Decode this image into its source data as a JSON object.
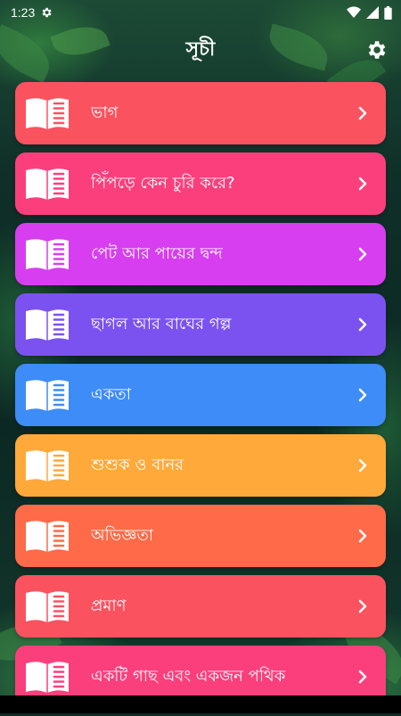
{
  "status_bar": {
    "time": "1:23",
    "icons": [
      "gear-icon",
      "wifi-icon",
      "signal-icon",
      "battery-icon"
    ]
  },
  "app_bar": {
    "title": "সূচী",
    "settings_icon": "gear-icon"
  },
  "list": {
    "item_icon": "book-icon",
    "trailing_icon": "chevron-right-icon",
    "items": [
      {
        "label": "ভাগ",
        "color": "#fb5260",
        "icon_color": "#fb5260"
      },
      {
        "label": "পিঁপড়ে কেন চুরি করে?",
        "color": "#fb3f7d",
        "icon_color": "#fb3f7d"
      },
      {
        "label": "পেট আর পায়ের দ্বন্দ",
        "color": "#d73ef0",
        "icon_color": "#d73ef0"
      },
      {
        "label": "ছাগল আর বাঘের গল্প",
        "color": "#7b52ef",
        "icon_color": "#7b52ef"
      },
      {
        "label": "একতা",
        "color": "#3d8cf7",
        "icon_color": "#3d8cf7"
      },
      {
        "label": "শুশুক ও বানর",
        "color": "#ffa93a",
        "icon_color": "#ffa93a"
      },
      {
        "label": "অভিজ্ঞতা",
        "color": "#ff6a48",
        "icon_color": "#ff6a48"
      },
      {
        "label": "প্রমাণ",
        "color": "#fb5260",
        "icon_color": "#fb5260"
      },
      {
        "label": "একটি গাছ এবং একজন পথিক",
        "color": "#fb3f7d",
        "icon_color": "#fb3f7d"
      }
    ]
  }
}
